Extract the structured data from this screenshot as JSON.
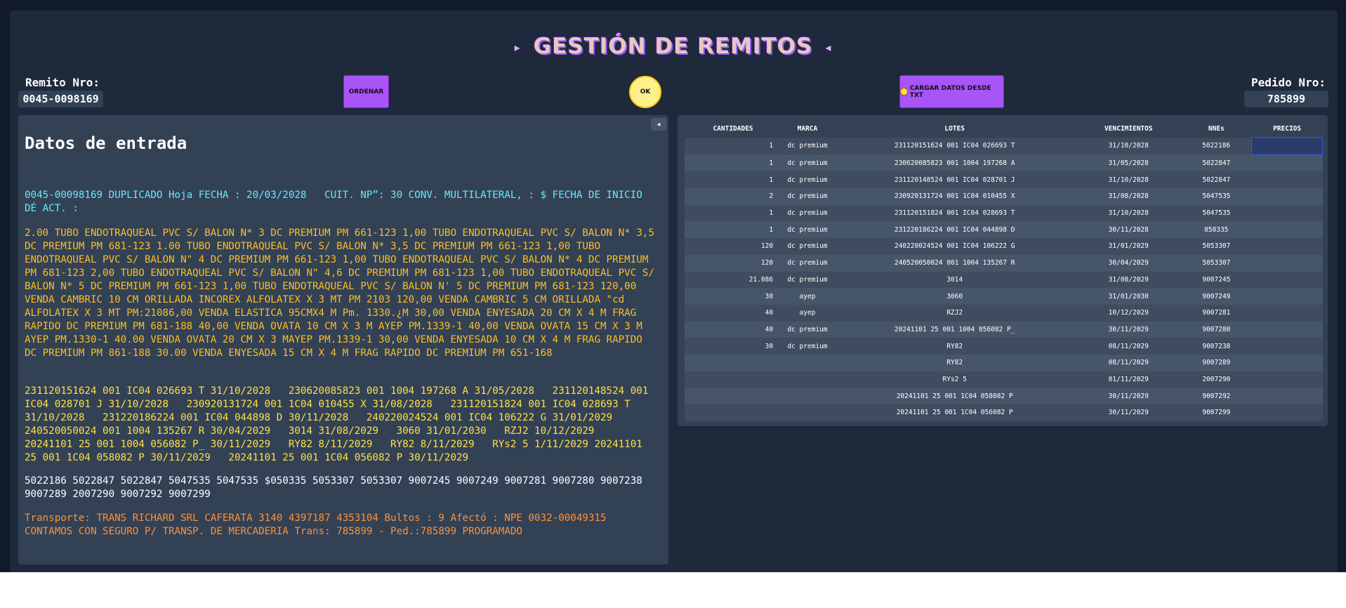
{
  "title": "GESTIÓN DE REMITOS",
  "title_arrows": {
    "left": "▸",
    "right": "◂"
  },
  "remito": {
    "label": "Remito Nro:",
    "value": "0045-0098169"
  },
  "pedido": {
    "label": "Pedido Nro:",
    "value": "785899"
  },
  "buttons": {
    "ordenar": "ORDENAR",
    "ok": "OK",
    "cargar": "CARGAR DATOS DESDE TXT"
  },
  "left": {
    "heading": "Datos de entrada",
    "collapse_icon": "◂",
    "p1": "0045-00098169 DUPLICADO Hoja FECHA : 20/03/2028   CUIT. NP”: 30 CONV. MULTILATERAL, : $ FECHA DE INICIO DÉ ACT. :",
    "p2": "2.00 TUBO ENDOTRAQUEAL PVC S/ BALON N* 3 DC PREMIUM PM 661-123 1,00 TUBO ENDOTRAQUEAL PVC S/ BALON N* 3,5 DC PREMIUM PM 681-123 1.00 TUBO ENDOTRAQUEAL PVC S/ BALON N* 3,5 DC PREMIUM PM 661-123 1,00 TUBO ENDOTRAQUEAL PVC S/ BALON N\" 4 DC PREMIUM PM 661-123 1,00 TUBO ENDOTRAQUEAL PVC S/ BALON N* 4 DC PREMIUM PM 681-123 2,00 TUBO ENDOTRAQUEAL PVC S/ BALON N\" 4,6 DC PREMIUM PM 681-123 1,00 TUBO ENDOTRAQUEAL PVC S/ BALON N* 5 DC PREMIUM PM 661-123 1,00 TUBO ENDOTRAQUEAL PVC S/ BALON N' 5 DC PREMIUM PM 681-123 120,00 VENDA CAMBRIC 10 CM ORILLADA INCOREX ALFOLATEX X 3 MT PM 2103 120,00 VENDA CAMBRIC 5 CM ORILLADA \"cd ALFOLATEX X 3 MT PM:21086,00 VENDA ELASTICA 95CMX4 M Pm. 1330.¿M 30,00 VENDA ENYESADA 20 CM X 4 M FRAG RAPIDO DC PREMIUM PM 681-188 40,00 VENDA OVATA 10 CM X 3 M AYEP PM.1339-1 40,00 VENDA OVATA 15 CM X 3 M AYEP PM.1330-1 40.00 VENDA OVATA 20 CM X 3 MAYEP PM.1339-1 30,00 VENDA ENYESADA 10 CM X 4 M FRAG RAPIDO DC PREMIUM PM 861-188 30.00 VENDA ENYESADA 15 CM X 4 M FRAG RAPIDO DC PREMIUM PM 651-168",
    "p3": "231120151624 001 IC04 026693 T 31/10/2028   230620085823 001 1004 197268 A 31/05/2028   231120148524 001 IC04 028701 J 31/10/2028   230920131724 001 1C04 010455 X 31/08/2028   231120151824 001 IC04 028693 T 31/10/2028   231220186224 001 IC04 044898 D 30/11/2028   240220024524 001 IC04 106222 G 31/01/2029   240520050024 001 1004 135267 R 30/04/2029   3014 31/08/2029   3060 31/01/2030   RZJ2 10/12/2029   20241101 25 001 1004 056082 P_ 30/11/2029   RY82 8/11/2029   RY82 8/11/2029   RYs2 5 1/11/2029 20241101 25 001 1C04 058082 P 30/11/2029   20241101 25 001 1C04 056082 P 30/11/2029",
    "p4": "5022186 5022847 5022847 5047535 5047535 $050335 5053307 5053307 9007245 9007249 9007281 9007280 9007238 9007289 2007290 9007292 9007299",
    "p5": "Transporte: TRANS RICHARD SRL CAFERATA 3140 4397187 4353104 Bultos : 9 Afectó : NPE 0032-00049315 CONTAMOS CON SEGURO P/ TRANSP. DE MERCADERIA Trans: 785899 - Ped.:785899 PROGRAMADO"
  },
  "table": {
    "headers": [
      "CANTIDADES",
      "MARCA",
      "LOTES",
      "VENCIMIENTOS",
      "NNEs",
      "PRECIOS"
    ],
    "rows": [
      [
        "1",
        "dc premium",
        "231120151624 001 IC04 026693 T",
        "31/10/2028",
        "5022186",
        ""
      ],
      [
        "1",
        "dc premium",
        "230620085823 001 1004 197268 A",
        "31/05/2028",
        "5022847",
        ""
      ],
      [
        "1",
        "dc premium",
        "231120148524 001 IC04 028701 J",
        "31/10/2028",
        "5022847",
        ""
      ],
      [
        "2",
        "dc premium",
        "230920131724 001 1C04 010455 X",
        "31/08/2028",
        "5047535",
        ""
      ],
      [
        "1",
        "dc premium",
        "231120151824 001 IC04 028693 T",
        "31/10/2028",
        "5047535",
        ""
      ],
      [
        "1",
        "dc premium",
        "231220186224 001 IC04 044898 D",
        "30/11/2028",
        "050335",
        ""
      ],
      [
        "120",
        "dc premium",
        "240220024524 001 IC04 106222 G",
        "31/01/2029",
        "5053307",
        ""
      ],
      [
        "120",
        "dc premium",
        "240520050024 001 1004 135267 R",
        "30/04/2029",
        "5053307",
        ""
      ],
      [
        "21.086",
        "dc premium",
        "3014",
        "31/08/2029",
        "9007245",
        ""
      ],
      [
        "30",
        "ayep",
        "3060",
        "31/01/2030",
        "9007249",
        ""
      ],
      [
        "40",
        "ayep",
        "RZJ2",
        "10/12/2029",
        "9007281",
        ""
      ],
      [
        "40",
        "dc premium",
        "20241101 25 001 1004 056082 P_",
        "30/11/2029",
        "9007280",
        ""
      ],
      [
        "30",
        "dc premium",
        "RY82",
        "08/11/2029",
        "9007238",
        ""
      ],
      [
        "",
        "",
        "RY82",
        "08/11/2029",
        "9007289",
        ""
      ],
      [
        "",
        "",
        "RYs2 5",
        "01/11/2029",
        "2007290",
        ""
      ],
      [
        "",
        "",
        "20241101 25 001 1C04 058082 P",
        "30/11/2029",
        "9007292",
        ""
      ],
      [
        "",
        "",
        "20241101 25 001 1C04 056082 P",
        "30/11/2029",
        "9007299",
        ""
      ]
    ]
  },
  "colors": {
    "accent": "#a855f7",
    "ok": "#fef08a",
    "background": "#1e293b"
  }
}
